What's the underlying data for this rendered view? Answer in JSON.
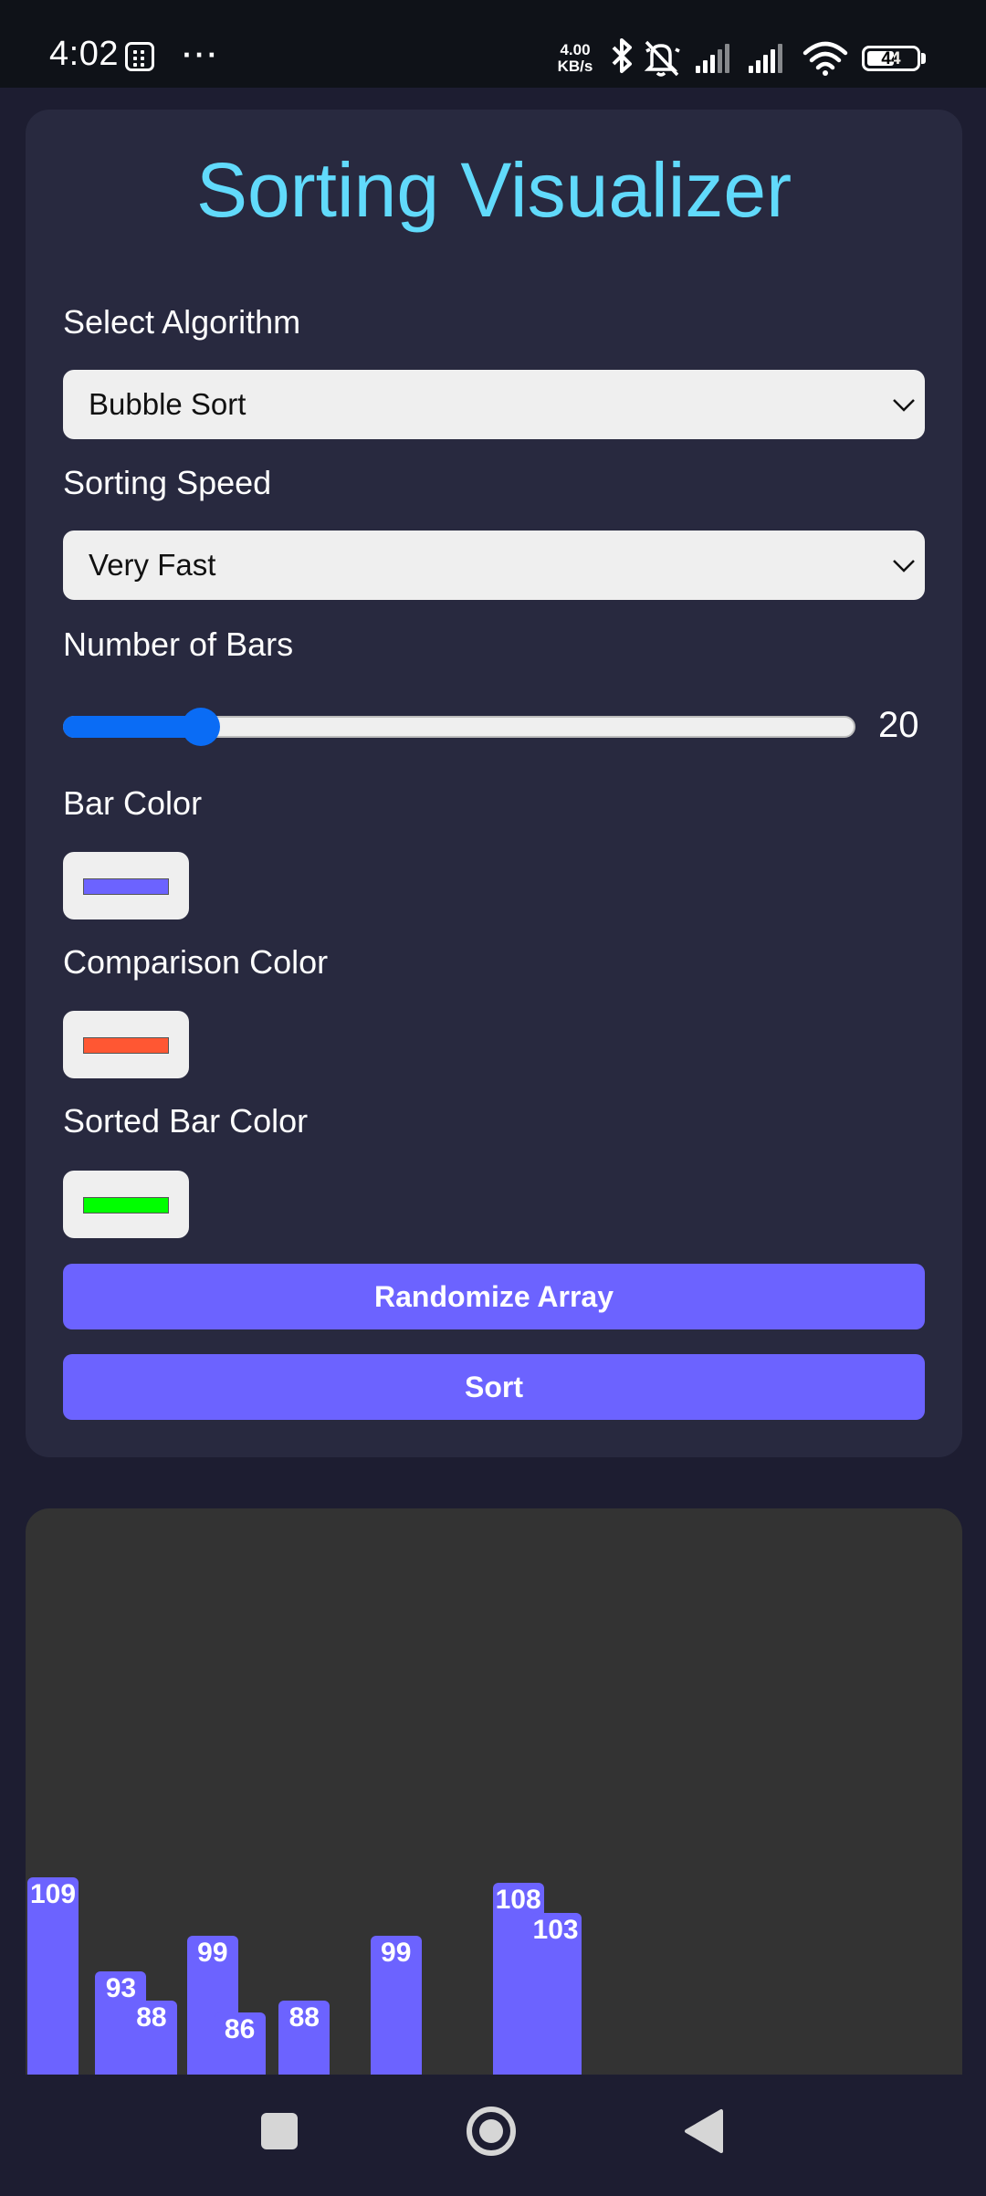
{
  "status_bar": {
    "time": "4:02",
    "more": "···",
    "net_speed_value": "4.00",
    "net_speed_unit": "KB/s",
    "battery": "44"
  },
  "app": {
    "title": "Sorting Visualizer",
    "algorithm_label": "Select Algorithm",
    "algorithm_value": "Bubble Sort",
    "speed_label": "Sorting Speed",
    "speed_value": "Very Fast",
    "bars_label": "Number of Bars",
    "bars_value": 20,
    "bars_min": 5,
    "bars_max": 100,
    "bar_color_label": "Bar Color",
    "bar_color": "#6c63ff",
    "comparison_color_label": "Comparison Color",
    "comparison_color": "#ff5733",
    "sorted_color_label": "Sorted Bar Color",
    "sorted_color": "#00ff00",
    "randomize_label": "Randomize Array",
    "sort_label": "Sort"
  },
  "chart_data": {
    "type": "bar",
    "visible_values": [
      109,
      93,
      88,
      99,
      86,
      88,
      99,
      108,
      103
    ]
  },
  "nav_bar": {
    "items": [
      "recents-icon",
      "home-icon",
      "back-icon"
    ]
  }
}
